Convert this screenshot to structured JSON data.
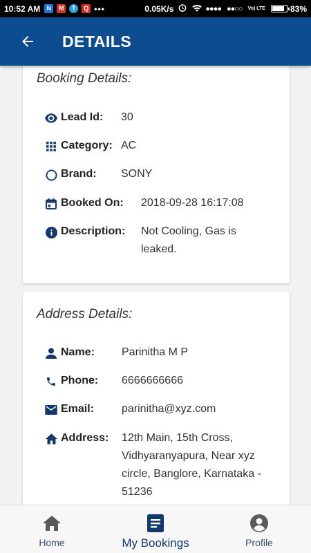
{
  "status_bar": {
    "time": "10:52 AM",
    "app_icons": [
      "N",
      "M",
      "T",
      "Q"
    ],
    "more": "•••",
    "speed": "0.05K/s",
    "signal": "●●●●",
    "signal2": "●●○○",
    "volte": "Vo) LTE",
    "battery_fraction": 0.83,
    "battery": "83%"
  },
  "appbar": {
    "title": "DETAILS"
  },
  "booking": {
    "section_title": "Booking Details:",
    "lead_id_label": "Lead Id:",
    "lead_id": "30",
    "category_label": "Category:",
    "category": "AC",
    "brand_label": "Brand:",
    "brand": "SONY",
    "booked_on_label": "Booked On:",
    "booked_on": "2018-09-28 16:17:08",
    "description_label": "Description:",
    "description": "Not Cooling, Gas is leaked."
  },
  "address": {
    "section_title": "Address Details:",
    "name_label": "Name:",
    "name": "Parinitha M P",
    "phone_label": "Phone:",
    "phone": "6666666666",
    "email_label": "Email:",
    "email": "parinitha@xyz.com",
    "address_label": "Address:",
    "address": "12th Main, 15th Cross, Vidhyaranyapura, Near xyz circle, Banglore, Karnataka - 51236"
  },
  "bottom_nav": {
    "home": "Home",
    "bookings": "My Bookings",
    "profile": "Profile",
    "active": "My Bookings"
  },
  "colors": {
    "primary": "#0d4c8f",
    "icon": "#12386e"
  }
}
